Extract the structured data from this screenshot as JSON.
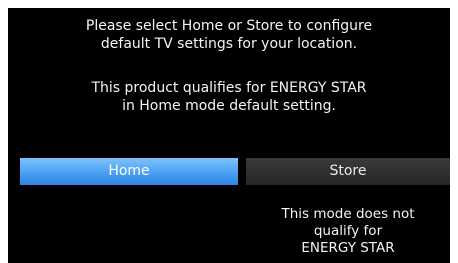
{
  "dialog": {
    "message_line1": "Please select Home or Store to configure\ndefault TV settings for your location.",
    "message_line2": "This product qualifies for ENERGY STAR\nin Home mode default setting."
  },
  "options": {
    "home_label": "Home",
    "store_label": "Store",
    "selected": "Home"
  },
  "store_note": "This mode does not\nqualify for\nENERGY STAR",
  "colors": {
    "background": "#000000",
    "selected_accent": "#4ea3f3",
    "unselected_button": "#2e2e2e",
    "text": "#f4f4f4"
  }
}
